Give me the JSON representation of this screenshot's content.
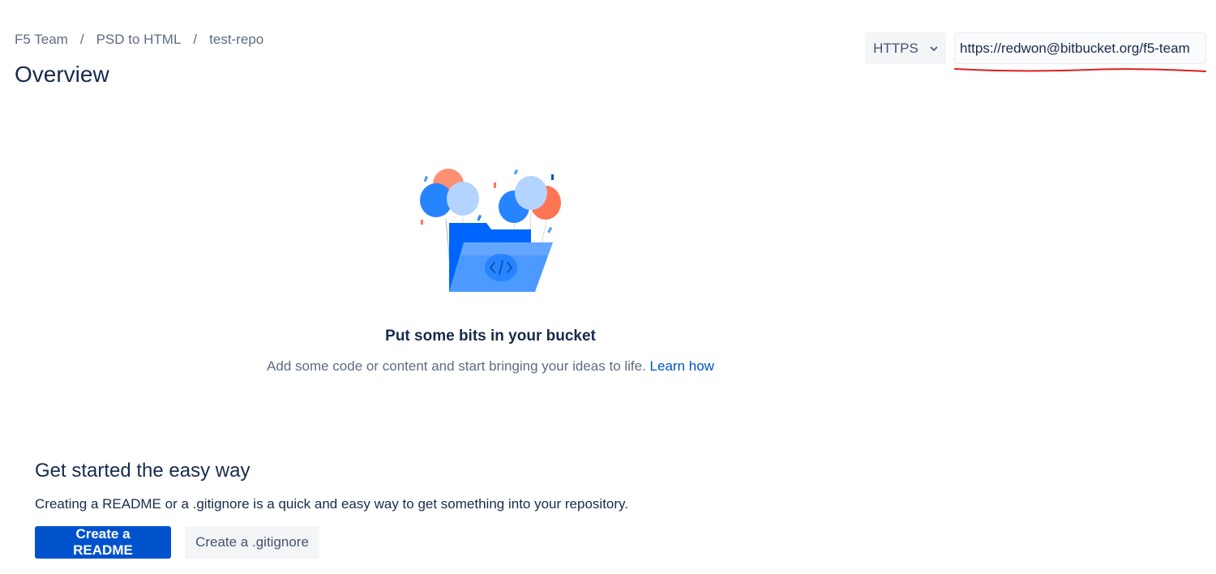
{
  "breadcrumb": [
    {
      "label": "F5 Team"
    },
    {
      "label": "PSD to HTML"
    },
    {
      "label": "test-repo"
    }
  ],
  "breadcrumb_separator": "/",
  "page_title": "Overview",
  "clone": {
    "protocol": "HTTPS",
    "url": "https://redwon@bitbucket.org/f5-team"
  },
  "empty_state": {
    "heading": "Put some bits in your bucket",
    "text": "Add some code or content and start bringing your ideas to life.",
    "link": "Learn how"
  },
  "get_started": {
    "heading": "Get started the easy way",
    "text": "Creating a README or a .gitignore is a quick and easy way to get something into your repository.",
    "create_readme": "Create a README",
    "create_gitignore": "Create a .gitignore"
  },
  "colors": {
    "primary": "#0052cc",
    "text": "#172b4d",
    "subtle": "#5e6c84",
    "annotation": "#e01e1e"
  }
}
